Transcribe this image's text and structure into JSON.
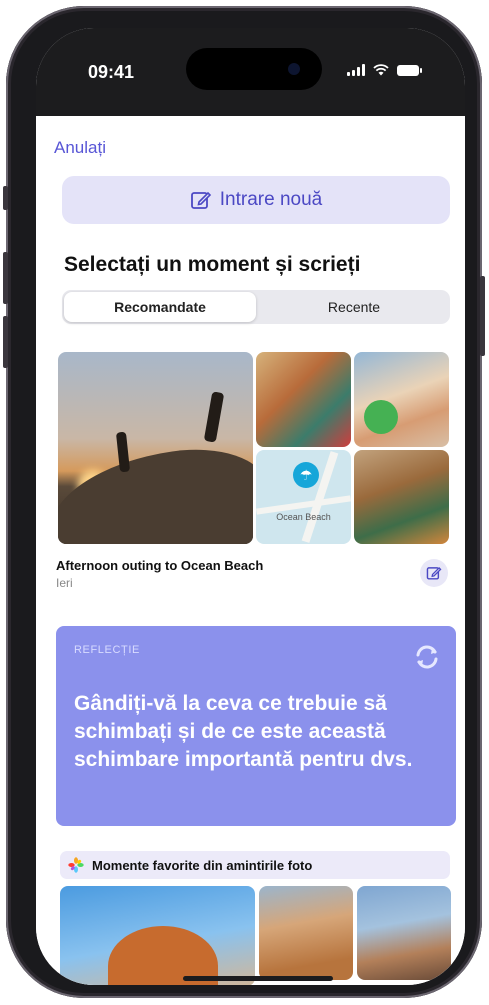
{
  "status_bar": {
    "time": "09:41"
  },
  "nav": {
    "cancel_label": "Anulați"
  },
  "new_entry": {
    "label": "Intrare nouă",
    "icon": "compose-icon"
  },
  "section": {
    "title": "Selectați un moment și scrieți"
  },
  "segmented_control": {
    "options": [
      "Recomandate",
      "Recente"
    ],
    "selected": "Recomandate"
  },
  "moment_card": {
    "title": "Afternoon outing to Ocean Beach",
    "subtitle": "Ieri",
    "map_label": "Ocean Beach",
    "edit_icon": "compose-icon"
  },
  "reflection": {
    "kicker": "REFLECȚIE",
    "prompt": "Gândiți-vă la ceva ce trebuie să schimbați și de ce este această schimbare importantă pentru dvs.",
    "background_color": "#8b91ec",
    "refresh_icon": "refresh-icon"
  },
  "favorites": {
    "label": "Momente favorite din amintirile foto",
    "icon": "photos-icon"
  },
  "colors": {
    "accent": "#5856d6"
  }
}
